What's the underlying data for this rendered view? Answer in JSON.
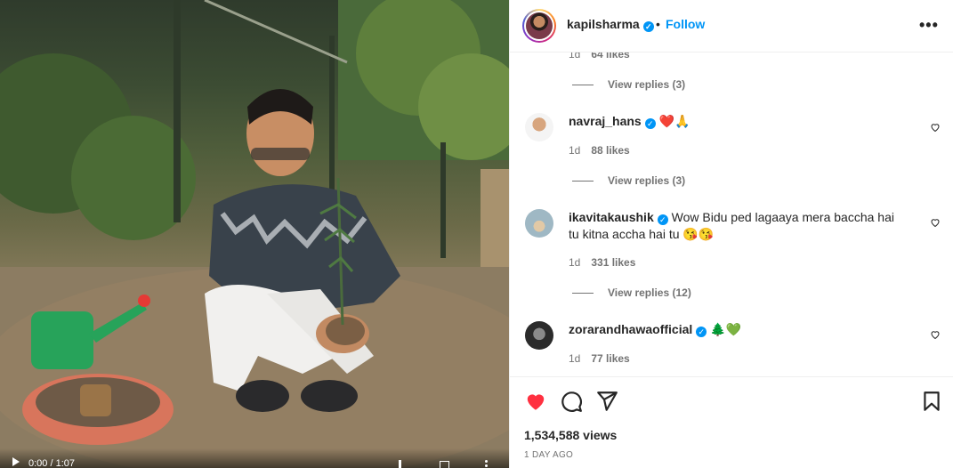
{
  "video": {
    "time": "0:00 / 1:07"
  },
  "header": {
    "username": "kapilsharma",
    "separator": "•",
    "follow_label": "Follow",
    "more_label": "•••"
  },
  "comments": {
    "top_partial": {
      "age": "1d",
      "likes": "64 likes",
      "replies": "View replies (3)"
    },
    "items": [
      {
        "username": "navraj_hans",
        "text": "❤️🙏",
        "age": "1d",
        "likes": "88 likes",
        "replies": "View replies (3)"
      },
      {
        "username": "ikavitakaushik",
        "text": "Wow Bidu ped lagaaya mera baccha hai tu kitna accha hai tu 😘😘",
        "age": "1d",
        "likes": "331 likes",
        "replies": "View replies (12)"
      },
      {
        "username": "zorarandhawaofficial",
        "text": "🌲💚",
        "age": "1d",
        "likes": "77 likes"
      }
    ]
  },
  "footer": {
    "views": "1,534,588 views",
    "date": "1 DAY AGO",
    "like_color": "#ff3040"
  }
}
